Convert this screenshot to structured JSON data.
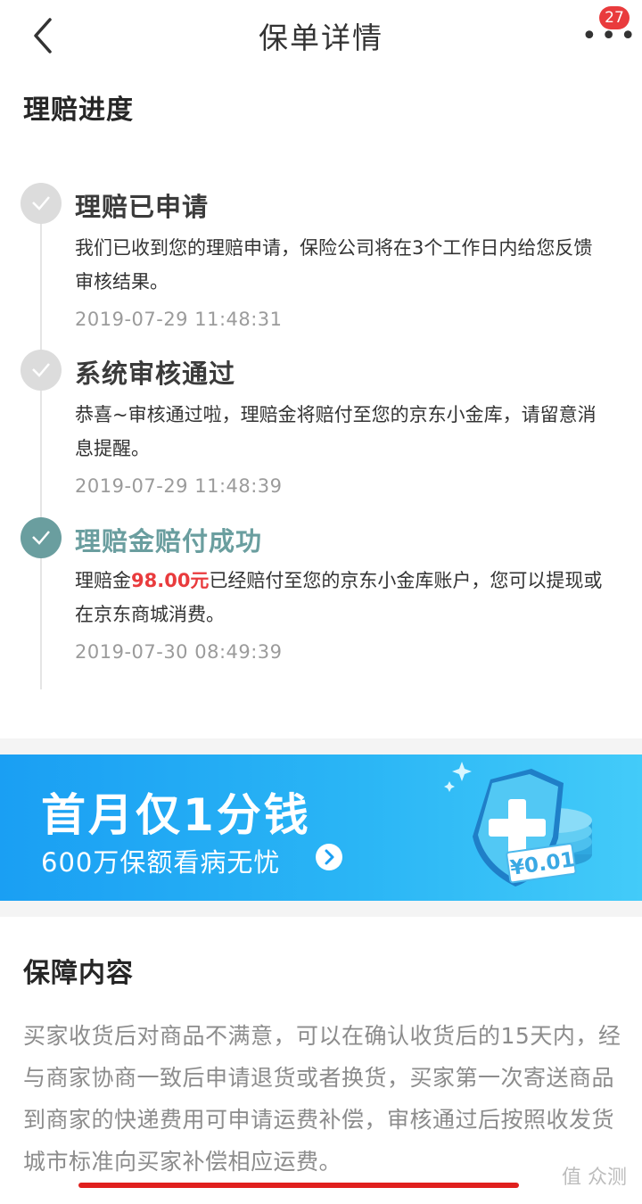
{
  "header": {
    "title": "保单详情",
    "badge_count": "27"
  },
  "progress": {
    "title": "理赔进度",
    "steps": [
      {
        "name": "理赔已申请",
        "desc": "我们已收到您的理赔申请，保险公司将在3个工作日内给您反馈审核结果。",
        "time": "2019-07-29 11:48:31"
      },
      {
        "name": "系统审核通过",
        "desc": "恭喜~审核通过啦，理赔金将赔付至您的京东小金库，请留意消息提醒。",
        "time": "2019-07-29 11:48:39"
      },
      {
        "name": "理赔金赔付成功",
        "desc_prefix": "理赔金",
        "amount": "98.00元",
        "desc_suffix": "已经赔付至您的京东小金库账户，您可以提现或在京东商城消费。",
        "time": "2019-07-30 08:49:39"
      }
    ]
  },
  "banner": {
    "headline": "首月仅1分钱",
    "sub": "600万保额看病无忧",
    "tag": "¥0.01"
  },
  "coverage": {
    "title": "保障内容",
    "text": "买家收货后对商品不满意，可以在确认收货后的15天内，经与商家协商一致后申请退货或者换货，买家第一次寄送商品到商家的快递费用可申请运费补偿，审核通过后按照收发货城市标准向买家补偿相应运费。"
  },
  "watermark": "值 众测"
}
